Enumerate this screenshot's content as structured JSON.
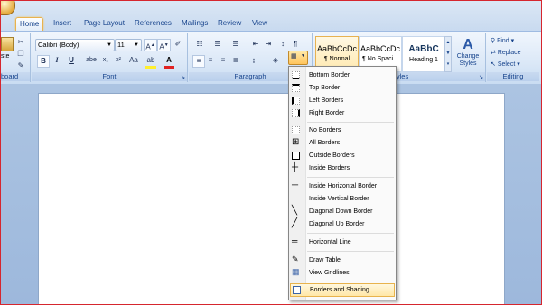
{
  "tabs": [
    {
      "label": "Home",
      "active": true
    },
    {
      "label": "Insert"
    },
    {
      "label": "Page Layout"
    },
    {
      "label": "References"
    },
    {
      "label": "Mailings"
    },
    {
      "label": "Review"
    },
    {
      "label": "View"
    }
  ],
  "clipboard": {
    "paste_label": "ste",
    "group_label": "board"
  },
  "font": {
    "family": "Calibri (Body)",
    "size": "11",
    "group_label": "Font"
  },
  "paragraph": {
    "group_label": "Paragraph"
  },
  "styles": {
    "items": [
      {
        "sample": "AaBbCcDc",
        "name": "¶ Normal"
      },
      {
        "sample": "AaBbCcDc",
        "name": "¶ No Spaci..."
      },
      {
        "sample": "AaBbC",
        "name": "Heading 1"
      }
    ],
    "change_styles": "Change Styles",
    "group_label": "Styles"
  },
  "editing": {
    "find": "Find",
    "replace": "Replace",
    "select": "Select",
    "group_label": "Editing"
  },
  "borders_menu": {
    "items": [
      {
        "label": "Bottom Border",
        "icon": "bottom-border-icon"
      },
      {
        "label": "Top Border",
        "icon": "top-border-icon"
      },
      {
        "label": "Left Borders",
        "icon": "left-border-icon"
      },
      {
        "label": "Right Border",
        "icon": "right-border-icon"
      },
      {
        "label": "No Borders",
        "icon": "no-border-icon"
      },
      {
        "label": "All Borders",
        "icon": "all-borders-icon"
      },
      {
        "label": "Outside Borders",
        "icon": "outside-borders-icon"
      },
      {
        "label": "Inside Borders",
        "icon": "inside-borders-icon"
      },
      {
        "label": "Inside Horizontal Border",
        "icon": "inside-horizontal-border-icon"
      },
      {
        "label": "Inside Vertical Border",
        "icon": "inside-vertical-border-icon"
      },
      {
        "label": "Diagonal Down Border",
        "icon": "diagonal-down-border-icon"
      },
      {
        "label": "Diagonal Up Border",
        "icon": "diagonal-up-border-icon"
      },
      {
        "label": "Horizontal Line",
        "icon": "horizontal-line-icon"
      },
      {
        "label": "Draw Table",
        "icon": "draw-table-icon"
      },
      {
        "label": "View Gridlines",
        "icon": "view-gridlines-icon"
      },
      {
        "label": "Borders and Shading...",
        "icon": "borders-shading-icon",
        "highlighted": true
      }
    ]
  }
}
